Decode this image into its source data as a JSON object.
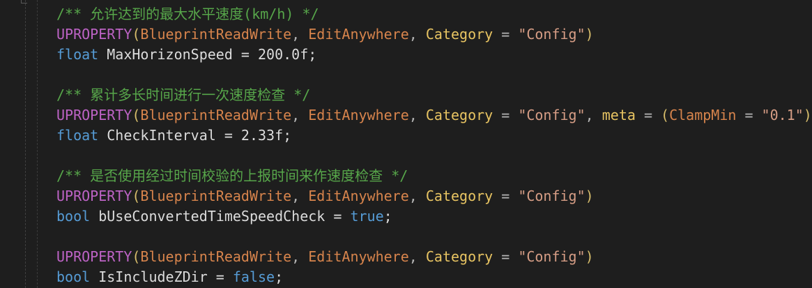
{
  "editor": {
    "lines": [
      {
        "tokens": [
          {
            "text": "/** 允许达到的最大水平速度(km/h) */",
            "cls": "tok-comment",
            "name": "code-comment"
          }
        ]
      },
      {
        "tokens": [
          {
            "text": "UPROPERTY",
            "cls": "tok-macro",
            "name": "macro-token"
          },
          {
            "text": "(",
            "cls": "tok-paren",
            "name": "punctuation-token"
          },
          {
            "text": "BlueprintReadWrite",
            "cls": "tok-orange",
            "name": "specifier-token"
          },
          {
            "text": ", ",
            "cls": "tok-punc",
            "name": "punctuation-token"
          },
          {
            "text": "EditAnywhere",
            "cls": "tok-orange",
            "name": "specifier-token"
          },
          {
            "text": ", ",
            "cls": "tok-punc",
            "name": "punctuation-token"
          },
          {
            "text": "Category",
            "cls": "tok-cat",
            "name": "specifier-token"
          },
          {
            "text": " = ",
            "cls": "tok-punc",
            "name": "punctuation-token"
          },
          {
            "text": "\"Config\"",
            "cls": "tok-string",
            "name": "string-token"
          },
          {
            "text": ")",
            "cls": "tok-paren",
            "name": "punctuation-token"
          }
        ]
      },
      {
        "tokens": [
          {
            "text": "float",
            "cls": "tok-keyword",
            "name": "keyword-token"
          },
          {
            "text": " MaxHorizonSpeed = 200.0f;",
            "cls": "tok-ident",
            "name": "identifier-token"
          }
        ]
      },
      {
        "tokens": []
      },
      {
        "tokens": [
          {
            "text": "/** 累计多长时间进行一次速度检查 */",
            "cls": "tok-comment",
            "name": "code-comment"
          }
        ]
      },
      {
        "tokens": [
          {
            "text": "UPROPERTY",
            "cls": "tok-macro",
            "name": "macro-token"
          },
          {
            "text": "(",
            "cls": "tok-paren",
            "name": "punctuation-token"
          },
          {
            "text": "BlueprintReadWrite",
            "cls": "tok-orange",
            "name": "specifier-token"
          },
          {
            "text": ", ",
            "cls": "tok-punc",
            "name": "punctuation-token"
          },
          {
            "text": "EditAnywhere",
            "cls": "tok-orange",
            "name": "specifier-token"
          },
          {
            "text": ", ",
            "cls": "tok-punc",
            "name": "punctuation-token"
          },
          {
            "text": "Category",
            "cls": "tok-cat",
            "name": "specifier-token"
          },
          {
            "text": " = ",
            "cls": "tok-punc",
            "name": "punctuation-token"
          },
          {
            "text": "\"Config\"",
            "cls": "tok-string",
            "name": "string-token"
          },
          {
            "text": ", ",
            "cls": "tok-punc",
            "name": "punctuation-token"
          },
          {
            "text": "meta",
            "cls": "tok-cat",
            "name": "specifier-token"
          },
          {
            "text": " = ",
            "cls": "tok-punc",
            "name": "punctuation-token"
          },
          {
            "text": "(",
            "cls": "tok-paren",
            "name": "punctuation-token"
          },
          {
            "text": "ClampMin",
            "cls": "tok-orange",
            "name": "specifier-token"
          },
          {
            "text": " = ",
            "cls": "tok-punc",
            "name": "punctuation-token"
          },
          {
            "text": "\"0.1\"",
            "cls": "tok-string",
            "name": "string-token"
          },
          {
            "text": "))",
            "cls": "tok-paren",
            "name": "punctuation-token"
          }
        ]
      },
      {
        "tokens": [
          {
            "text": "float",
            "cls": "tok-keyword",
            "name": "keyword-token"
          },
          {
            "text": " CheckInterval = 2.33f;",
            "cls": "tok-ident",
            "name": "identifier-token"
          }
        ]
      },
      {
        "tokens": []
      },
      {
        "tokens": [
          {
            "text": "/** 是否使用经过时间校验的上报时间来作速度检查 */",
            "cls": "tok-comment",
            "name": "code-comment"
          }
        ]
      },
      {
        "tokens": [
          {
            "text": "UPROPERTY",
            "cls": "tok-macro",
            "name": "macro-token"
          },
          {
            "text": "(",
            "cls": "tok-paren",
            "name": "punctuation-token"
          },
          {
            "text": "BlueprintReadWrite",
            "cls": "tok-orange",
            "name": "specifier-token"
          },
          {
            "text": ", ",
            "cls": "tok-punc",
            "name": "punctuation-token"
          },
          {
            "text": "EditAnywhere",
            "cls": "tok-orange",
            "name": "specifier-token"
          },
          {
            "text": ", ",
            "cls": "tok-punc",
            "name": "punctuation-token"
          },
          {
            "text": "Category",
            "cls": "tok-cat",
            "name": "specifier-token"
          },
          {
            "text": " = ",
            "cls": "tok-punc",
            "name": "punctuation-token"
          },
          {
            "text": "\"Config\"",
            "cls": "tok-string",
            "name": "string-token"
          },
          {
            "text": ")",
            "cls": "tok-paren",
            "name": "punctuation-token"
          }
        ]
      },
      {
        "tokens": [
          {
            "text": "bool",
            "cls": "tok-keyword",
            "name": "keyword-token"
          },
          {
            "text": " bUseConvertedTimeSpeedCheck = ",
            "cls": "tok-ident",
            "name": "identifier-token"
          },
          {
            "text": "true",
            "cls": "tok-keyword",
            "name": "keyword-token"
          },
          {
            "text": ";",
            "cls": "tok-ident",
            "name": "punctuation-token"
          }
        ]
      },
      {
        "tokens": []
      },
      {
        "tokens": [
          {
            "text": "UPROPERTY",
            "cls": "tok-macro",
            "name": "macro-token"
          },
          {
            "text": "(",
            "cls": "tok-paren",
            "name": "punctuation-token"
          },
          {
            "text": "BlueprintReadWrite",
            "cls": "tok-orange",
            "name": "specifier-token"
          },
          {
            "text": ", ",
            "cls": "tok-punc",
            "name": "punctuation-token"
          },
          {
            "text": "EditAnywhere",
            "cls": "tok-orange",
            "name": "specifier-token"
          },
          {
            "text": ", ",
            "cls": "tok-punc",
            "name": "punctuation-token"
          },
          {
            "text": "Category",
            "cls": "tok-cat",
            "name": "specifier-token"
          },
          {
            "text": " = ",
            "cls": "tok-punc",
            "name": "punctuation-token"
          },
          {
            "text": "\"Config\"",
            "cls": "tok-string",
            "name": "string-token"
          },
          {
            "text": ")",
            "cls": "tok-paren",
            "name": "punctuation-token"
          }
        ]
      },
      {
        "tokens": [
          {
            "text": "bool",
            "cls": "tok-keyword",
            "name": "keyword-token"
          },
          {
            "text": " IsIncludeZDir = ",
            "cls": "tok-ident",
            "name": "identifier-token"
          },
          {
            "text": "false",
            "cls": "tok-keyword",
            "name": "keyword-token"
          },
          {
            "text": ";",
            "cls": "tok-ident",
            "name": "punctuation-token"
          }
        ]
      }
    ]
  }
}
